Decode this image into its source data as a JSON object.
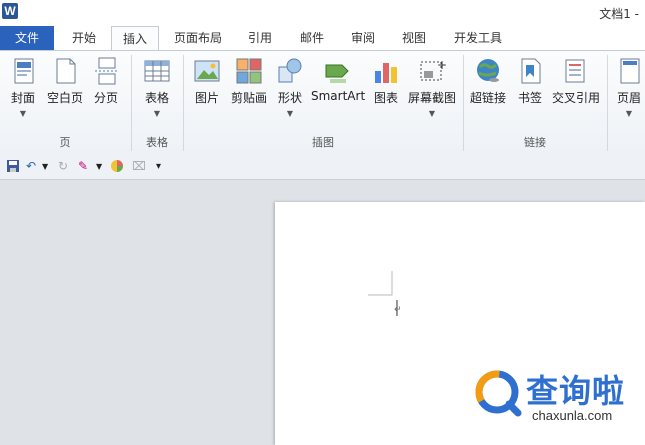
{
  "window": {
    "app_icon_letter": "W",
    "title": "文档1 -"
  },
  "tabs": [
    {
      "label": "文件"
    },
    {
      "label": "开始"
    },
    {
      "label": "插入"
    },
    {
      "label": "页面布局"
    },
    {
      "label": "引用"
    },
    {
      "label": "邮件"
    },
    {
      "label": "审阅"
    },
    {
      "label": "视图"
    },
    {
      "label": "开发工具"
    }
  ],
  "active_tab": "插入",
  "ribbon": {
    "buttons": [
      {
        "label": "封面",
        "icon": "cover-page-icon",
        "dropdown": true
      },
      {
        "label": "空白页",
        "icon": "blank-page-icon",
        "dropdown": false
      },
      {
        "label": "分页",
        "icon": "page-break-icon",
        "dropdown": false
      },
      {
        "label": "表格",
        "icon": "table-icon",
        "dropdown": true
      },
      {
        "label": "图片",
        "icon": "picture-icon",
        "dropdown": false
      },
      {
        "label": "剪贴画",
        "icon": "clip-art-icon",
        "dropdown": false
      },
      {
        "label": "形状",
        "icon": "shapes-icon",
        "dropdown": true
      },
      {
        "label": "SmartArt",
        "icon": "smartart-icon",
        "dropdown": false
      },
      {
        "label": "图表",
        "icon": "chart-icon",
        "dropdown": false
      },
      {
        "label": "屏幕截图",
        "icon": "screenshot-icon",
        "dropdown": true
      },
      {
        "label": "超链接",
        "icon": "hyperlink-icon",
        "dropdown": false
      },
      {
        "label": "书签",
        "icon": "bookmark-icon",
        "dropdown": false
      },
      {
        "label": "交叉引用",
        "icon": "cross-reference-icon",
        "dropdown": false
      },
      {
        "label": "页眉",
        "icon": "header-icon",
        "dropdown": true
      }
    ],
    "groups": [
      {
        "label": "页"
      },
      {
        "label": "表格"
      },
      {
        "label": "插图"
      },
      {
        "label": "链接"
      }
    ]
  },
  "quick_access": {
    "items": [
      "save-icon",
      "undo-icon",
      "redo-icon",
      "format-painter-icon",
      "color-icon",
      "clear-format-icon",
      "customize-qat-icon"
    ]
  },
  "watermark": {
    "brand_cn": "查询啦",
    "brand_en": "chaxunla.com"
  },
  "colors": {
    "file_tab": "#2a62bc",
    "brand": "#2f6fd0"
  }
}
